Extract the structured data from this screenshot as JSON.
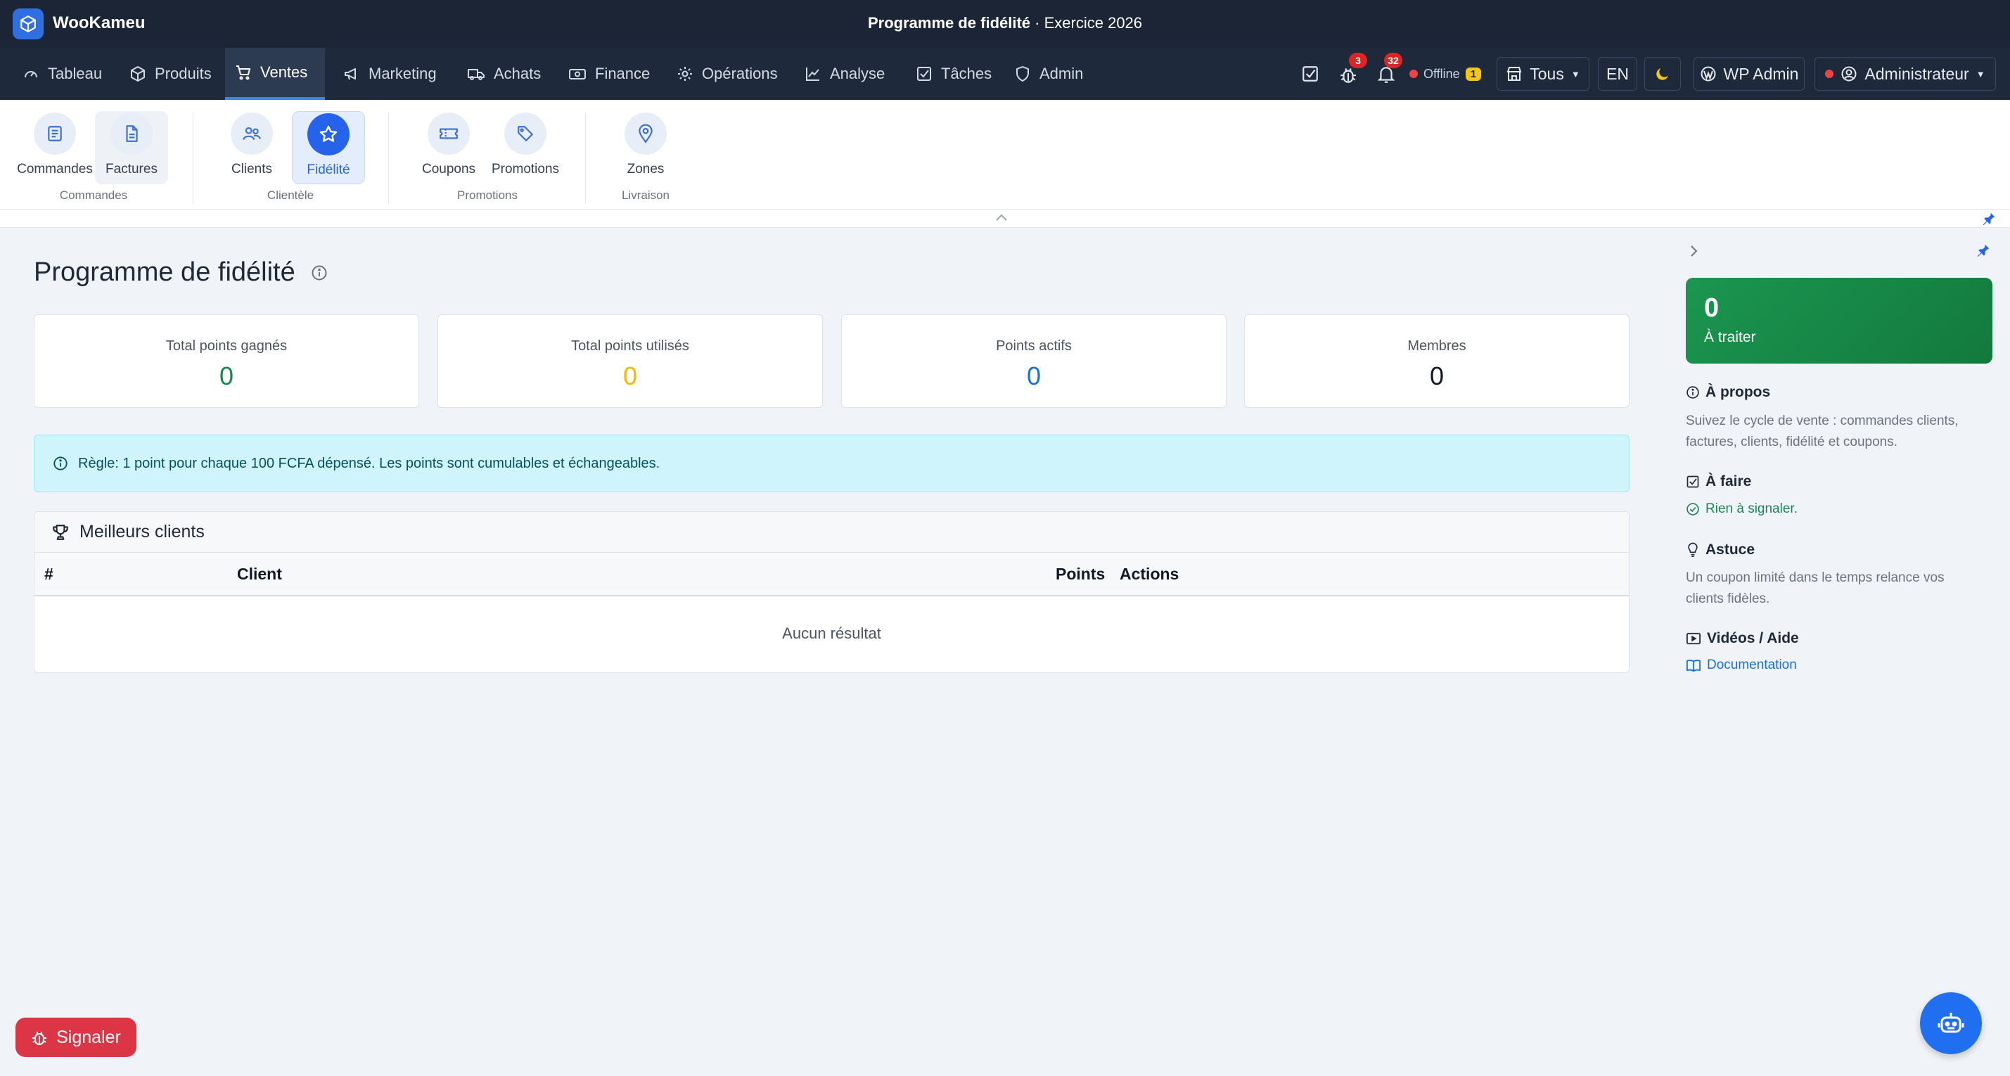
{
  "app": {
    "name": "WooKameu"
  },
  "window": {
    "title": "Programme de fidélité",
    "subtitle": "· Exercice 2026"
  },
  "nav": {
    "items": [
      {
        "label": "Tableau",
        "icon": "dashboard-gauge-icon"
      },
      {
        "label": "Produits",
        "icon": "box-icon"
      },
      {
        "label": "Ventes",
        "icon": "cart-icon",
        "active": true
      },
      {
        "label": "Marketing",
        "icon": "megaphone-icon"
      },
      {
        "label": "Achats",
        "icon": "truck-icon"
      },
      {
        "label": "Finance",
        "icon": "cash-icon"
      },
      {
        "label": "Opérations",
        "icon": "gear-icon"
      },
      {
        "label": "Analyse",
        "icon": "chart-line-icon"
      },
      {
        "label": "Tâches",
        "icon": "checkbox-icon"
      },
      {
        "label": "Admin",
        "icon": "shield-icon"
      }
    ],
    "bug_badge": "3",
    "bell_badge": "32",
    "offline_label": "Offline",
    "offline_count": "1",
    "store_select": "Tous",
    "lang": "EN",
    "wp_admin": "WP Admin",
    "user": "Administrateur"
  },
  "subnav": {
    "items": [
      {
        "label": "Commandes"
      },
      {
        "label": "Factures"
      },
      {
        "label": "Clients"
      },
      {
        "label": "Fidélité"
      },
      {
        "label": "Coupons"
      },
      {
        "label": "Promotions"
      },
      {
        "label": "Zones"
      }
    ],
    "groups": [
      "Commandes",
      "Clientèle",
      "Promotions",
      "Livraison"
    ]
  },
  "page": {
    "title": "Programme de fidélité",
    "stats": [
      {
        "label": "Total points gagnés",
        "value": "0",
        "color": "#198754"
      },
      {
        "label": "Total points utilisés",
        "value": "0",
        "color": "#f5b800"
      },
      {
        "label": "Points actifs",
        "value": "0",
        "color": "#1a6fe0"
      },
      {
        "label": "Membres",
        "value": "0",
        "color": "#111827"
      }
    ],
    "rule": "Règle: 1 point pour chaque 100 FCFA dépensé. Les points sont cumulables et échangeables.",
    "top_clients": {
      "title": "Meilleurs clients",
      "columns": [
        "#",
        "Client",
        "Points",
        "Actions"
      ],
      "empty": "Aucun résultat"
    }
  },
  "right_panel": {
    "todo_count": "0",
    "todo_label": "À traiter",
    "about_title": "À propos",
    "about_text": "Suivez le cycle de vente : commandes clients, factures, clients, fidélité et coupons.",
    "todo_title": "À faire",
    "todo_status": "Rien à signaler.",
    "tip_title": "Astuce",
    "tip_text": "Un coupon limité dans le temps relance vos clients fidèles.",
    "videos_title": "Vidéos / Aide",
    "doc_link": "Documentation"
  },
  "floating": {
    "report": "Signaler"
  }
}
